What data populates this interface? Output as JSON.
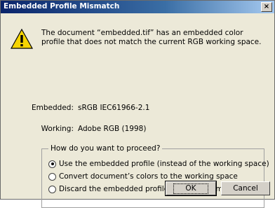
{
  "dialog": {
    "title": "Embedded Profile Mismatch",
    "close_label": "×",
    "message": "The document “embedded.tif” has an embedded color profile that does not match the current RGB working space.",
    "embedded_label": "Embedded:",
    "embedded_value": "sRGB IEC61966-2.1",
    "working_label": "Working:",
    "working_value": "Adobe RGB (1998)",
    "group_title": "How do you want to proceed?",
    "options": [
      {
        "label": "Use the embedded profile (instead of the working space)",
        "selected": true
      },
      {
        "label": "Convert document’s colors to the working space",
        "selected": false
      },
      {
        "label": "Discard the embedded profile (don’t color manage)",
        "selected": false
      }
    ],
    "ok_label": "OK",
    "cancel_label": "Cancel"
  },
  "colors": {
    "title_bar_start": "#0a246a",
    "title_bar_end": "#a6caf0",
    "dialog_bg": "#ece9d8",
    "warning_yellow": "#f5d400"
  },
  "icons": {
    "warning": "warning-icon",
    "close": "close-icon"
  }
}
